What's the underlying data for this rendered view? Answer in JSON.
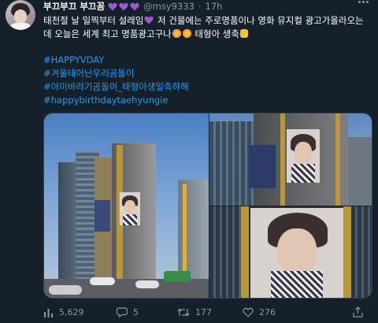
{
  "tweet": {
    "display_name": "부끄부끄 부끄꼼",
    "hearts": [
      "purple-heart",
      "purple-heart",
      "purple-heart"
    ],
    "handle": "@msy9333",
    "separator": "·",
    "time": "17h",
    "line1_a": "태천절 날 일찍부터 설레임",
    "line1_b": " 저 건물에는 주로명품이나 영화 뮤지컬 광고가올라오는",
    "line2_a": "데 오늘은 세계 최고 명품광고구나",
    "line2_b": " 태형아 생축",
    "hashtags": [
      "#HAPPYVDAY",
      "#겨울태어난우리곰돌이",
      "#아미바라기곰돌이_태형아생일축하해",
      "#happybirthdaytaehyungie"
    ],
    "stats": {
      "views": "5,629",
      "replies": "5",
      "retweets": "177",
      "likes": "276"
    }
  },
  "photos": {
    "left": "street-view-of-building-with-billboard",
    "top_right": "building-facade-with-billboard",
    "bottom_right": "billboard-closeup"
  },
  "colors": {
    "background": "#15202b",
    "link": "#1d9bf0",
    "muted": "#8b98a5",
    "heart": "#9b59d0"
  }
}
